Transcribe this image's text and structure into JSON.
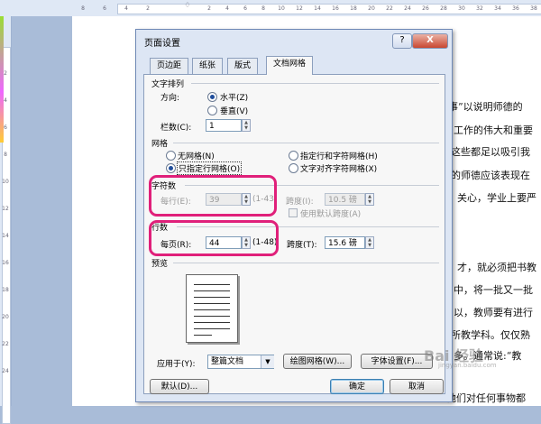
{
  "dialog": {
    "title": "页面设置",
    "help_label": "?",
    "close_label": "X",
    "tabs": [
      {
        "label": "页边距"
      },
      {
        "label": "纸张"
      },
      {
        "label": "版式"
      },
      {
        "label": "文档网格"
      }
    ],
    "text_direction": {
      "group_label": "文字排列",
      "direction_label": "方向:",
      "horizontal": "水平(Z)",
      "vertical": "垂直(V)",
      "columns_label": "栏数(C):",
      "columns_value": "1"
    },
    "grid": {
      "group_label": "网格",
      "no_grid": "无网格(N)",
      "lines_only": "只指定行网格(O)",
      "lines_and_chars": "指定行和字符网格(H)",
      "snap_to_chars": "文字对齐字符网格(X)"
    },
    "characters": {
      "group_label": "字符数",
      "per_line_label": "每行(E):",
      "per_line_value": "39",
      "per_line_range": "(1-43)",
      "pitch_label": "跨度(I):",
      "pitch_value": "10.5 磅",
      "use_default_label": "使用默认跨度(A)"
    },
    "lines": {
      "group_label": "行数",
      "per_page_label": "每页(R):",
      "per_page_value": "44",
      "per_page_range": "(1-48)",
      "pitch_label": "跨度(T):",
      "pitch_value": "15.6 磅"
    },
    "preview_label": "预览",
    "apply_to_label": "应用于(Y):",
    "apply_to_value": "整篇文档",
    "draw_grid_button": "绘图网格(W)...",
    "font_settings_button": "字体设置(F)...",
    "default_button": "默认(D)...",
    "ok_button": "确定",
    "cancel_button": "取消"
  },
  "document": {
    "lines": [
      "事”以说明师德的",
      "工作的伟大和重要",
      "这些都足以吸引我",
      "的师德应该表现在",
      "关心，学业上要严",
      "才，就必须把书教",
      "中，将一批又一批",
      "以，教师要有进行",
      "所教学科。仅仅熟",
      "多。通常说:“教",
      "他们对任何事物都"
    ]
  },
  "ruler": {
    "numbers": [
      "8",
      "6",
      "4",
      "2",
      "2",
      "4",
      "6",
      "8",
      "10",
      "12",
      "14",
      "16",
      "18",
      "20",
      "22",
      "24",
      "26",
      "28",
      "30",
      "32",
      "34",
      "36",
      "38"
    ],
    "left_numbers": [
      "2",
      "4",
      "6",
      "8",
      "10",
      "12",
      "14",
      "16",
      "18",
      "20",
      "22",
      "24"
    ]
  },
  "watermark": "Bai 经验",
  "watermark_sub": "jingyan.baidu.com"
}
